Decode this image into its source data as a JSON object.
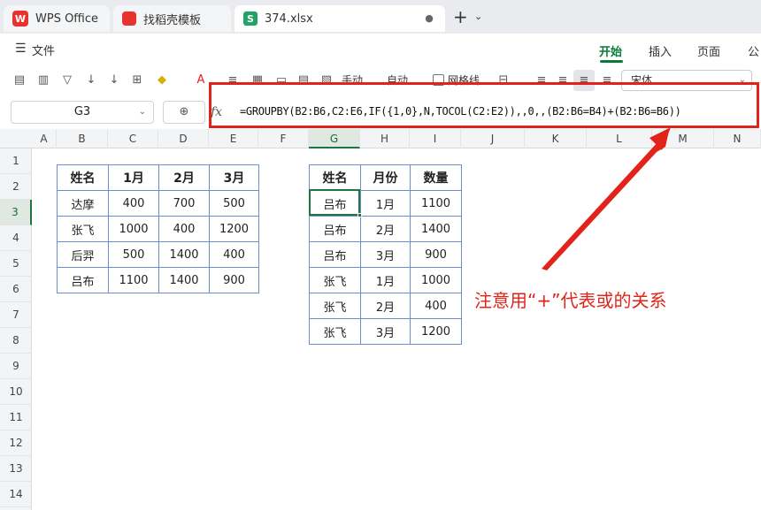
{
  "tabs": {
    "wps": "WPS Office",
    "template": "找稻壳模板",
    "file": "374.xlsx"
  },
  "menu": {
    "file": "文件",
    "tabs": [
      "开始",
      "插入",
      "页面",
      "公"
    ]
  },
  "toolbar": {
    "manual": "手动",
    "auto": "自动",
    "gridlines": "网格线",
    "font": "宋体"
  },
  "formula": {
    "cell_ref": "G3",
    "fx": "fx",
    "text": "=GROUPBY(B2:B6,C2:E6,IF({1,0},N,TOCOL(C2:E2)),,0,,(B2:B6=B4)+(B2:B6=B6))"
  },
  "grid": {
    "columns": [
      "A",
      "B",
      "C",
      "D",
      "E",
      "F",
      "G",
      "H",
      "I",
      "J",
      "K",
      "L",
      "M",
      "N"
    ],
    "rows": [
      "1",
      "2",
      "3",
      "4",
      "5",
      "6",
      "7",
      "8",
      "9",
      "10",
      "11",
      "12",
      "13",
      "14"
    ],
    "active_column": "G",
    "active_row": "3"
  },
  "left_table": {
    "headers": [
      "姓名",
      "1月",
      "2月",
      "3月"
    ],
    "rows": [
      [
        "达摩",
        "400",
        "700",
        "500"
      ],
      [
        "张飞",
        "1000",
        "400",
        "1200"
      ],
      [
        "后羿",
        "500",
        "1400",
        "400"
      ],
      [
        "吕布",
        "1100",
        "1400",
        "900"
      ]
    ]
  },
  "right_table": {
    "headers": [
      "姓名",
      "月份",
      "数量"
    ],
    "rows": [
      [
        "吕布",
        "1月",
        "1100"
      ],
      [
        "吕布",
        "2月",
        "1400"
      ],
      [
        "吕布",
        "3月",
        "900"
      ],
      [
        "张飞",
        "1月",
        "1000"
      ],
      [
        "张飞",
        "2月",
        "400"
      ],
      [
        "张飞",
        "3月",
        "1200"
      ]
    ]
  },
  "annotation": "注意用“+”代表或的关系",
  "colors": {
    "accent_green": "#217346",
    "annotation_red": "#e2231a",
    "table_border": "#6b8fc9"
  }
}
